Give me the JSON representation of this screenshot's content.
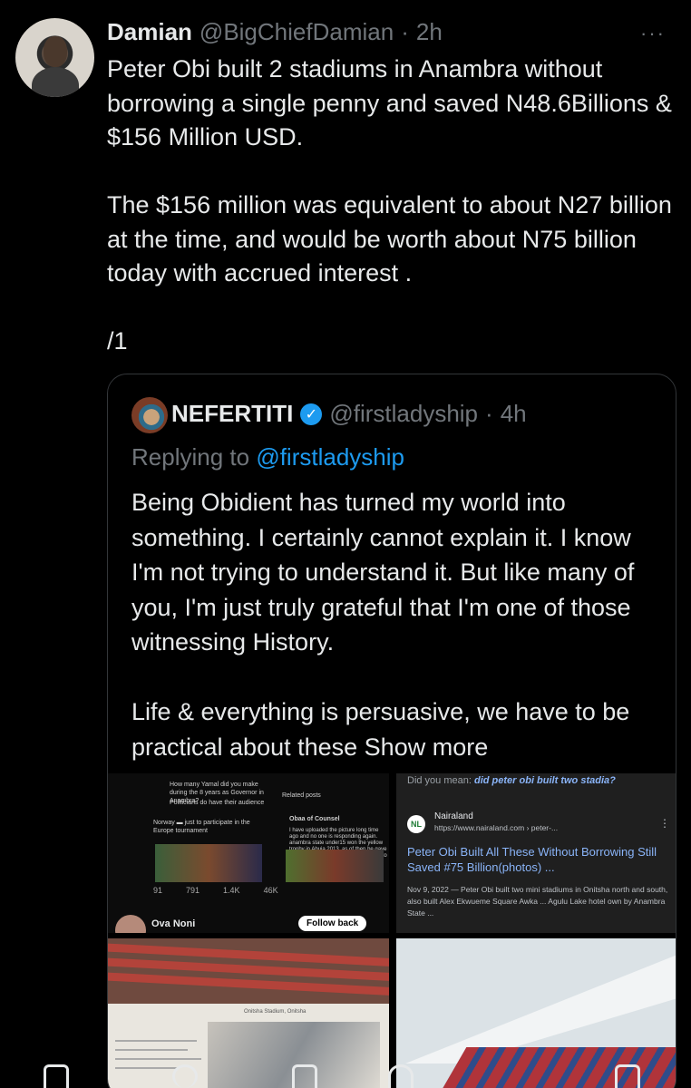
{
  "tweet": {
    "name": "Damian",
    "handle": "@BigChiefDamian",
    "dot": "·",
    "time": "2h",
    "more": "···",
    "text": "Peter Obi built 2 stadiums in Anambra without borrowing a single penny and saved N48.6Billions &  $156 Million USD.\n\nThe $156 million was equivalent to about N27 billion at the time, and would be worth about N75 billion today with accrued interest .\n\n/1"
  },
  "quote": {
    "name": "NEFERTITI",
    "verified_icon": "verified-badge-icon",
    "handle": "@firstladyship",
    "dot": "·",
    "time": "4h",
    "replying_prefix": "Replying to",
    "replying_handle": "@firstladyship",
    "text": "Being Obidient has turned my world into something. I certainly cannot explain it. I know I'm not trying to understand it. But like many of you, I'm just truly grateful that I'm one of those witnessing History.\n\nLife & everything is persuasive, we have to be practical about these ",
    "show_more": "Show more"
  },
  "media": {
    "m1": {
      "question": "How many Yamal did you make during the 8 years as Governor in Anambra?",
      "politicians": "Politicians do have their audience",
      "norway": "Norway ▬ just to participate in the Europe tournament",
      "related": "Related posts",
      "obaa": "Obaa of Counsel",
      "obaa_text": "I have uploaded the picture long time ago and no one is responding again. anambra state under15 won the yellow trophy in Abuja 2013, as of then he gave our team 2m plus a trip to Norway just to participate in the Europe tournament",
      "stats": [
        "91",
        "791",
        "1.4K",
        "46K"
      ],
      "user": "Ova Noni",
      "follow": "Follow back"
    },
    "m2": {
      "did_you_mean": "Did you mean:",
      "did_you_mean_query": "did peter obi built two stadia?",
      "site_name": "Nairaland",
      "site_url": "https://www.nairaland.com › peter-...",
      "site_icon": "NL",
      "result_title": "Peter Obi Built All These Without Borrowing Still Saved #75 Billion(photos) ...",
      "snippet": "Nov 9, 2022 — Peter Obi built two mini stadiums in Onitsha north and south, also built Alex Ekwueme Square Awka ... Agulu Lake hotel own by Anambra State ..."
    },
    "m3": {
      "caption": "Onitsha Stadium, Onitsha"
    }
  },
  "nav": {
    "icons": [
      "home-icon",
      "search-icon",
      "compose-icon",
      "communities-icon",
      "messages-icon"
    ]
  }
}
